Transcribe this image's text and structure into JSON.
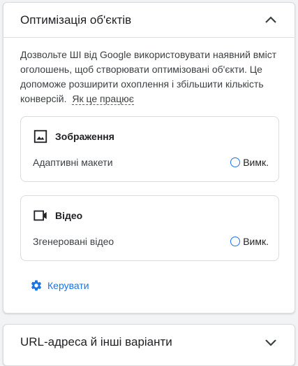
{
  "colors": {
    "accent": "#1a73e8",
    "border": "#dadce0",
    "background": "#f1f3f4"
  },
  "card_optimization": {
    "title": "Оптимізація об'єктів",
    "chevron_icon": "chevron-up-icon",
    "description": "Дозвольте ШІ від Google використовувати наявний вміст оголошень, щоб створювати оптимізовані об'єкти. Це допоможе розширити охоплення і збільшити кількість конверсій.",
    "learn_more": "Як це працює",
    "options": [
      {
        "icon": "image-icon",
        "title": "Зображення",
        "setting": "Адаптивні макети",
        "state": "Вимк."
      },
      {
        "icon": "video-camera-icon",
        "title": "Відео",
        "setting": "Згенеровані відео",
        "state": "Вимк."
      }
    ],
    "manage": {
      "icon": "gear-icon",
      "label": "Керувати"
    }
  },
  "card_url": {
    "title": "URL-адреса й інші варіанти",
    "chevron_icon": "chevron-down-icon"
  }
}
